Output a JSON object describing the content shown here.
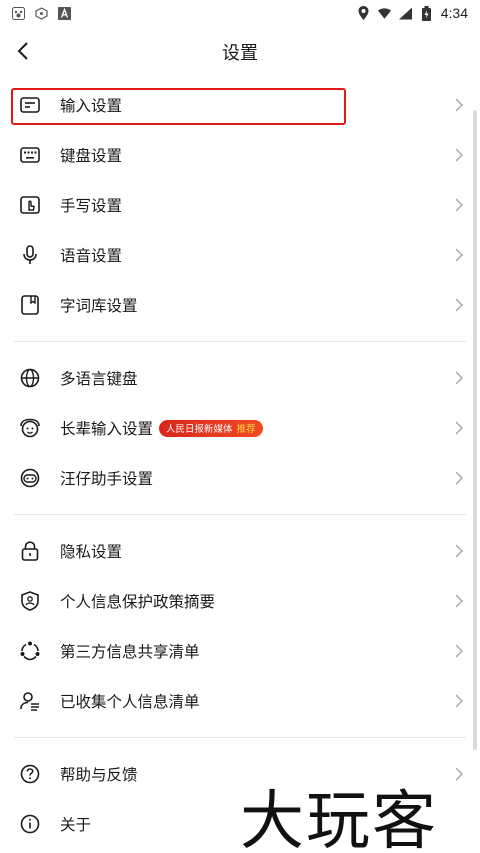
{
  "status_bar": {
    "time": "4:34",
    "left_icons": [
      "paw-icon",
      "shield-outline-icon",
      "letter-a-icon"
    ],
    "right_icons": [
      "location-icon",
      "wifi-icon",
      "signal-icon",
      "battery-icon"
    ]
  },
  "header": {
    "title": "设置",
    "back_icon": "chevron-left-icon"
  },
  "sections": [
    {
      "items": [
        {
          "label": "输入设置",
          "icon": "input-box-icon",
          "highlighted": true
        },
        {
          "label": "键盘设置",
          "icon": "keyboard-icon"
        },
        {
          "label": "手写设置",
          "icon": "handwriting-icon"
        },
        {
          "label": "语音设置",
          "icon": "microphone-icon"
        },
        {
          "label": "字词库设置",
          "icon": "bookmark-icon"
        }
      ]
    },
    {
      "items": [
        {
          "label": "多语言键盘",
          "icon": "globe-icon"
        },
        {
          "label": "长辈输入设置",
          "icon": "elder-face-icon",
          "badge": {
            "text": "人民日报新媒体",
            "tag": "推荐"
          }
        },
        {
          "label": "汪仔助手设置",
          "icon": "dog-face-icon"
        }
      ]
    },
    {
      "items": [
        {
          "label": "隐私设置",
          "icon": "lock-icon"
        },
        {
          "label": "个人信息保护政策摘要",
          "icon": "shield-person-icon"
        },
        {
          "label": "第三方信息共享清单",
          "icon": "share-cycle-icon"
        },
        {
          "label": "已收集个人信息清单",
          "icon": "person-list-icon"
        }
      ]
    },
    {
      "items": [
        {
          "label": "帮助与反馈",
          "icon": "help-icon"
        },
        {
          "label": "关于",
          "icon": "info-icon"
        }
      ]
    }
  ],
  "watermark": "大玩客",
  "colors": {
    "accent_red": "#e01a1a",
    "text": "#1a1a1a",
    "divider": "#e6e6e6"
  }
}
